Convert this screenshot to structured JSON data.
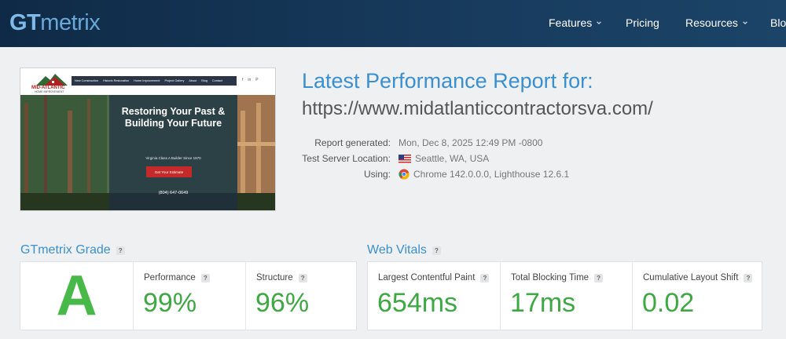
{
  "header": {
    "logo_gt": "GT",
    "logo_metrix": "metrix",
    "nav": [
      {
        "label": "Features",
        "dropdown": true
      },
      {
        "label": "Pricing",
        "dropdown": false
      },
      {
        "label": "Resources",
        "dropdown": true
      },
      {
        "label": "Blog",
        "dropdown": false
      }
    ]
  },
  "thumbnail": {
    "brand": "MID-ATLANTIC",
    "brand_sub": "HOME IMPROVEMENT",
    "nav": [
      "New Construction",
      "Historic Restoration",
      "Home Improvement",
      "Project Gallery",
      "About",
      "Blog",
      "Contact"
    ],
    "social": [
      "f",
      "in",
      "P"
    ],
    "headline": "Restoring Your Past & Building Your Future",
    "subline": "Virginia Class A Builder Since 1970",
    "cta": "Get Your Estimate",
    "phone": "(804) 647-0649"
  },
  "report": {
    "title": "Latest Performance Report for:",
    "url": "https://www.midatlanticcontractorsva.com/",
    "meta": {
      "generated_label": "Report generated:",
      "generated_value": "Mon, Dec 8, 2025 12:49 PM -0800",
      "server_label": "Test Server Location:",
      "server_value": "Seattle, WA, USA",
      "using_label": "Using:",
      "using_value": "Chrome 142.0.0.0, Lighthouse 12.6.1"
    }
  },
  "grade_section": {
    "title": "GTmetrix Grade",
    "help": "?",
    "grade": "A",
    "performance_label": "Performance",
    "performance_value": "99%",
    "structure_label": "Structure",
    "structure_value": "96%"
  },
  "vitals_section": {
    "title": "Web Vitals",
    "help": "?",
    "lcp_label": "Largest Contentful Paint",
    "lcp_value": "654ms",
    "tbt_label": "Total Blocking Time",
    "tbt_value": "17ms",
    "cls_label": "Cumulative Layout Shift",
    "cls_value": "0.02"
  },
  "colors": {
    "accent_blue": "#3a8fd0",
    "grade_green": "#48b849",
    "header_dark": "#0f2a46"
  }
}
